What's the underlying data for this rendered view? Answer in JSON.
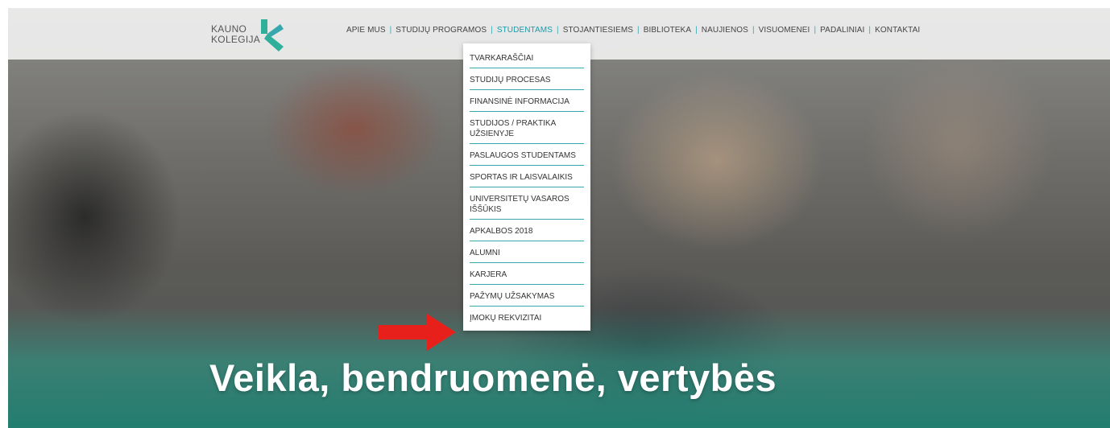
{
  "logo": {
    "line1": "KAUNO",
    "line2": "KOLEGIJA",
    "icon": "kk-logo-icon"
  },
  "nav": {
    "items": [
      "APIE MUS",
      "STUDIJŲ PROGRAMOS",
      "STUDENTAMS",
      "STOJANTIESIEMS",
      "BIBLIOTEKA",
      "NAUJIENOS",
      "VISUOMENEI",
      "PADALINIAI",
      "KONTAKTAI"
    ],
    "active": "STUDENTAMS"
  },
  "dropdown": {
    "items": [
      "TVARKARAŠČIAI",
      "STUDIJŲ PROCESAS",
      "FINANSINĖ INFORMACIJA",
      "STUDIJOS / PRAKTIKA UŽSIENYJE",
      "PASLAUGOS STUDENTAMS",
      "SPORTAS IR LAISVALAIKIS",
      "UNIVERSITETŲ VASAROS IŠŠŪKIS",
      "APKALBOS 2018",
      "ALUMNI",
      "KARJERA",
      "PAŽYMŲ UŽSAKYMAS",
      "ĮMOKŲ REKVIZITAI"
    ]
  },
  "hero": {
    "headline": "Veikla, bendruomenė, vertybės"
  },
  "colors": {
    "accent": "#1a9aa8",
    "separator": "#3aa8b2",
    "arrow": "#e8201b",
    "logo_green": "#2fb09a",
    "logo_teal": "#37a7ad"
  }
}
